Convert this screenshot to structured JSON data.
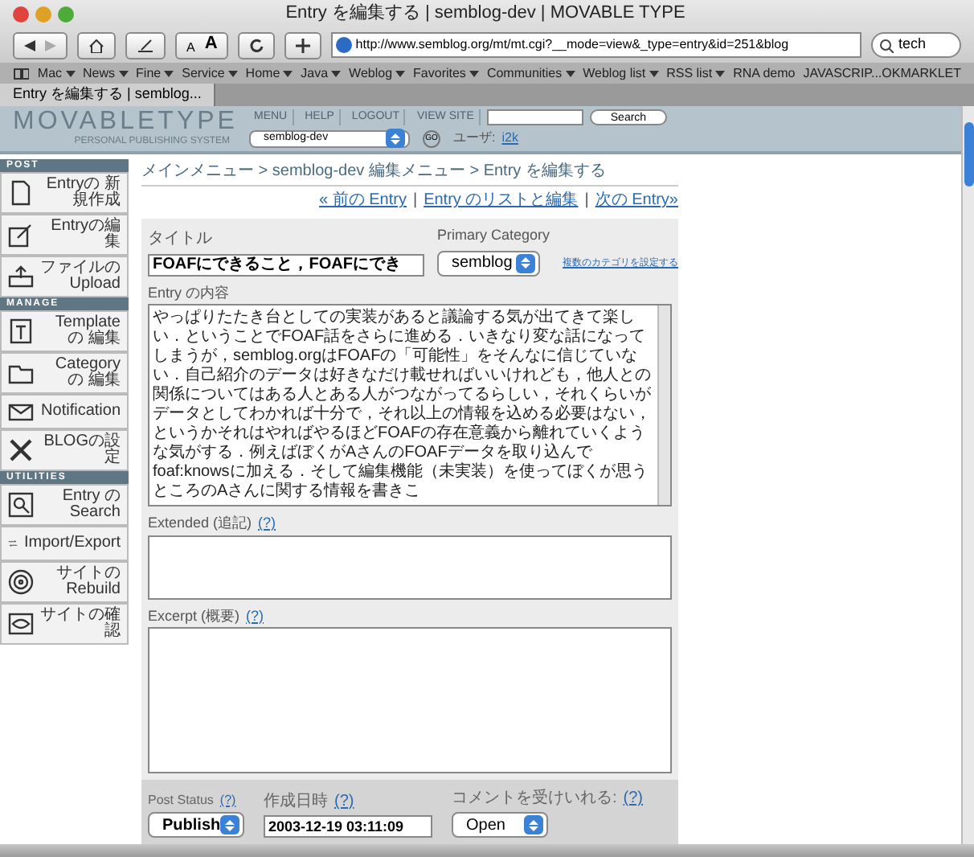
{
  "window": {
    "title": "Entry を編集する | semblog-dev | MOVABLE TYPE"
  },
  "toolbar": {
    "text_sizes": [
      "A",
      "A"
    ],
    "url": "http://www.semblog.org/mt/mt.cgi?__mode=view&_type=entry&id=251&blog",
    "search": "tech"
  },
  "bookmarks": [
    {
      "label": "Mac",
      "menu": true
    },
    {
      "label": "News",
      "menu": true
    },
    {
      "label": "Fine",
      "menu": true
    },
    {
      "label": "Service",
      "menu": true
    },
    {
      "label": "Home",
      "menu": true
    },
    {
      "label": "Java",
      "menu": true
    },
    {
      "label": "Weblog",
      "menu": true
    },
    {
      "label": "Favorites",
      "menu": true
    },
    {
      "label": "Communities",
      "menu": true
    },
    {
      "label": "Weblog list",
      "menu": true
    },
    {
      "label": "RSS list",
      "menu": true
    },
    {
      "label": "RNA demo",
      "menu": false
    },
    {
      "label": "JAVASCRIP...OKMARKLET",
      "menu": false
    }
  ],
  "tabs": [
    {
      "label": "Entry を編集する | semblog...",
      "selected": true
    }
  ],
  "header": {
    "logo": "MOVABLETYPE",
    "tagline": "PERSONAL PUBLISHING SYSTEM",
    "nav": [
      "MENU",
      "HELP",
      "LOGOUT",
      "VIEW SITE"
    ],
    "search_button": "Search",
    "blog": "semblog-dev",
    "go": "GO",
    "user_label": "ユーザ:",
    "user": "i2k"
  },
  "sidebar": [
    {
      "heading": "POST",
      "items": [
        {
          "kind": "page",
          "label": "Entryの 新規作成"
        },
        {
          "kind": "pencil",
          "label": "Entryの編集"
        },
        {
          "kind": "upload",
          "label": "ファイルの Upload"
        }
      ]
    },
    {
      "heading": "MANAGE",
      "items": [
        {
          "kind": "template",
          "label": "Templateの 編集"
        },
        {
          "kind": "category",
          "label": "Categoryの 編集"
        },
        {
          "kind": "mail",
          "label": "Notification"
        },
        {
          "kind": "tools",
          "label": "BLOGの設定"
        }
      ]
    },
    {
      "heading": "UTILITIES",
      "items": [
        {
          "kind": "search",
          "label": "Entry の Search"
        },
        {
          "kind": "arrows",
          "label": "Import/Export"
        },
        {
          "kind": "target",
          "label": "サイトの Rebuild"
        },
        {
          "kind": "eye",
          "label": "サイトの確認"
        }
      ]
    }
  ],
  "breadcrumb": "メインメニュー > semblog-dev 編集メニュー > Entry を編集する",
  "entry_nav": {
    "links": [
      "« 前の Entry",
      "Entry のリストと編集",
      "次の Entry»"
    ],
    "separator": "|"
  },
  "form": {
    "title_label": "タイトル",
    "title_value": "FOAFにできること，FOAFにでき",
    "category_label": "Primary Category",
    "category": "semblog",
    "category_link": "複数のカテゴリを設定する",
    "body_label": "Entry の内容",
    "body": "やっぱりたたき台としての実装があると議論する気が出てきて楽しい．ということでFOAF話をさらに進める．いきなり変な話になってしまうが，semblog.orgはFOAFの「可能性」をそんなに信じていない．自己紹介のデータは好きなだけ載せればいいけれども，他人との関係についてはある人とある人がつながってるらしい，それくらいがデータとしてわかれば十分で，それ以上の情報を込める必要はない，というかそれはやればやるほどFOAFの存在意義から離れていくような気がする．例えばぼくがAさんのFOAFデータを取り込んでfoaf:knowsに加える．そして編集機能（未実装）を使ってぼくが思うところのAさんに関する情報を書きこ",
    "extended_label": "Extended (追記)",
    "excerpt_label": "Excerpt (概要)",
    "help": "(?)"
  },
  "footer": {
    "status_label": "Post Status",
    "status": "Publish",
    "date_label": "作成日時",
    "date": "2003-12-19 03:11:09",
    "comments_label": "コメントを受けいれる:",
    "comments": "Open",
    "help": "(?)"
  }
}
